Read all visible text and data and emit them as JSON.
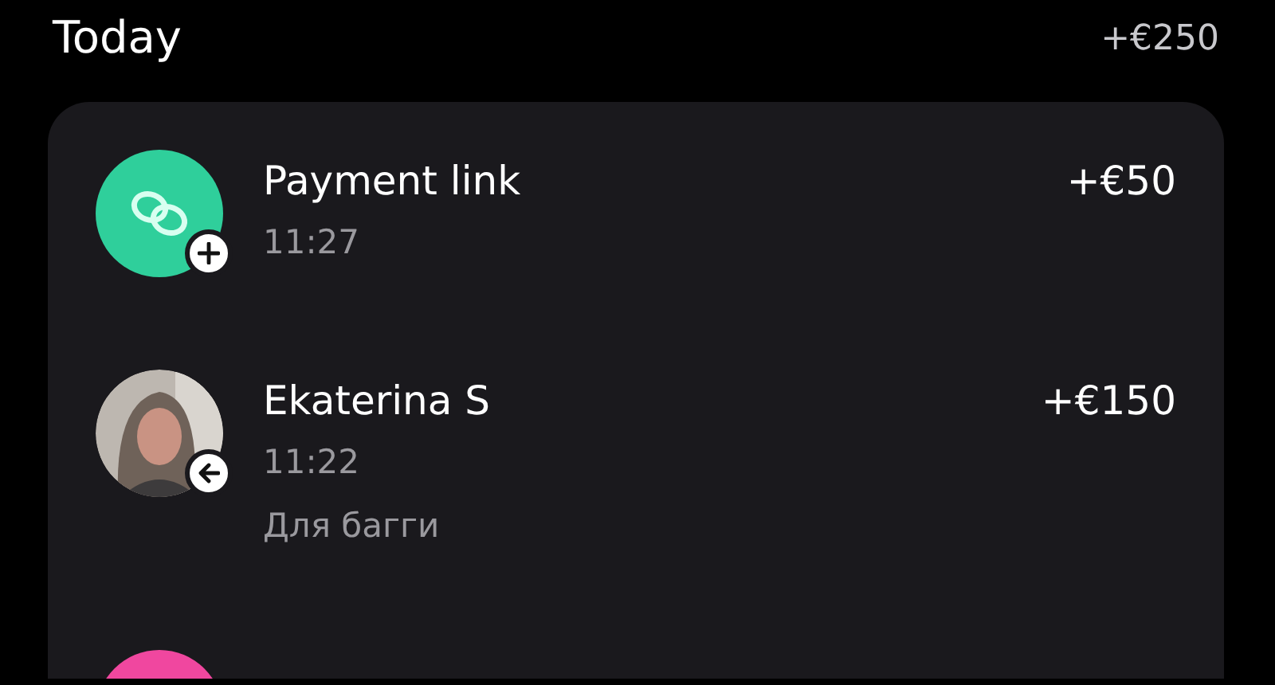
{
  "section": {
    "title": "Today",
    "total": "+€250"
  },
  "transactions": [
    {
      "avatar": {
        "kind": "link",
        "color": "#2fcf9b"
      },
      "badge": {
        "kind": "plus"
      },
      "name": "Payment link",
      "time": "11:27",
      "amount": "+€50"
    },
    {
      "badge": {
        "kind": "arrow"
      },
      "name": "Ekaterina S",
      "time": "11:22",
      "note": "Для багги",
      "amount": "+€150"
    },
    {
      "avatar": {
        "kind": "plain",
        "color": "#f0479f"
      }
    }
  ]
}
